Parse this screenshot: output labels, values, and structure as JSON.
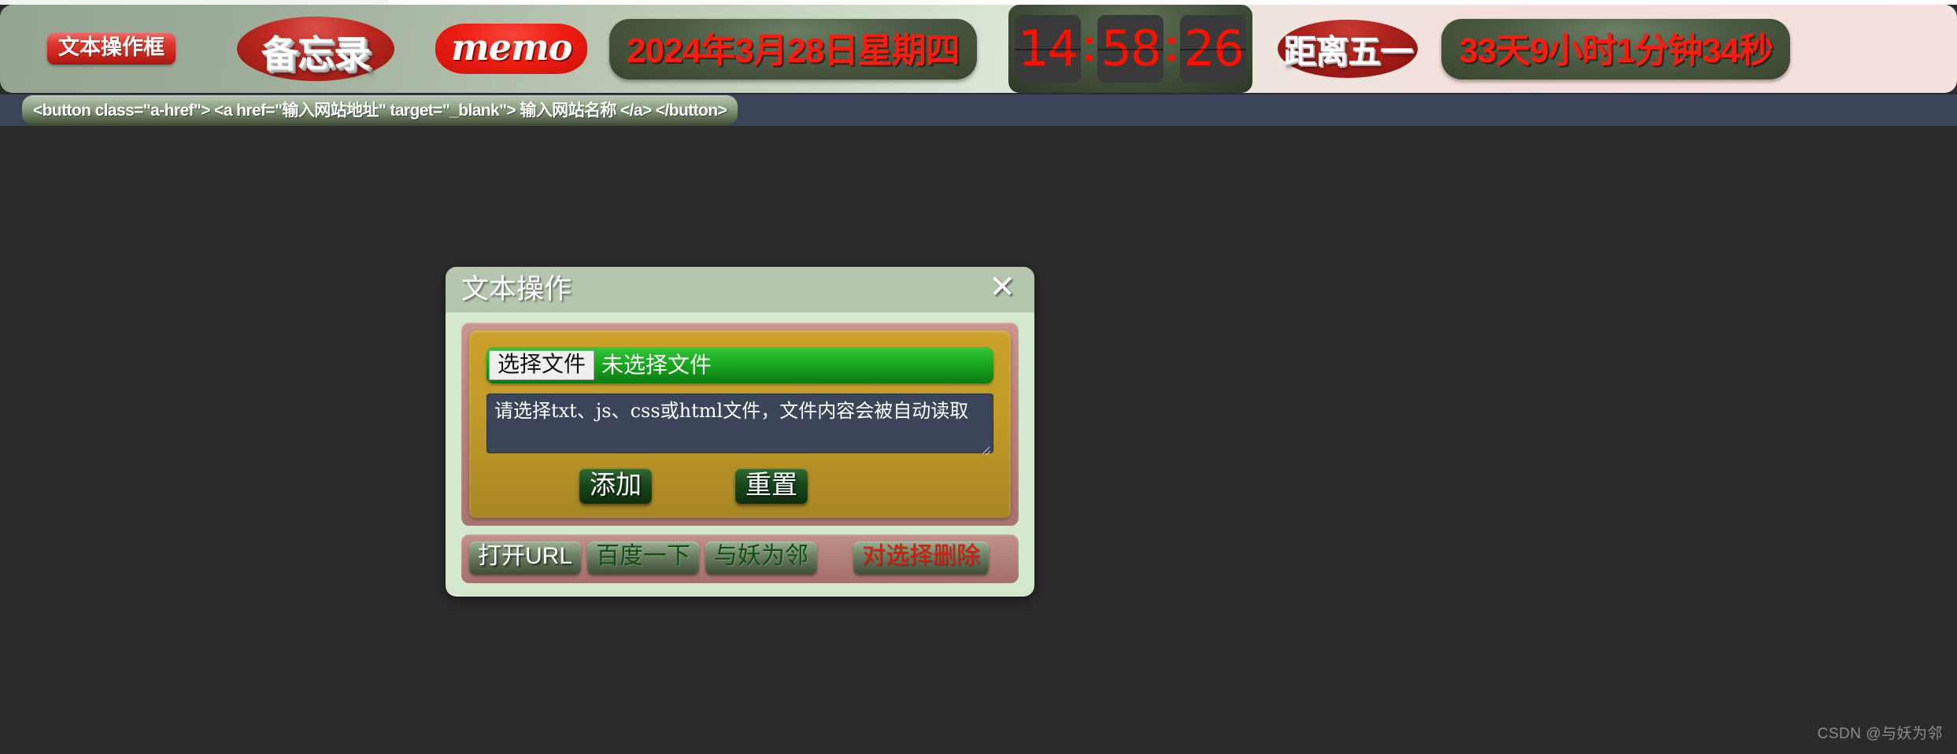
{
  "toolbar": {
    "text_box_button": "文本操作框",
    "memo_cn_button": "备忘录",
    "memo_en_button": "memo",
    "date_display": "2024年3月28日星期四",
    "clock": {
      "hours": "14",
      "minutes": "58",
      "seconds": "26",
      "separator": ":",
      "full": "14:58:26"
    },
    "countdown_label": "距离五一",
    "countdown_value": "33天9小时1分钟34秒"
  },
  "codebar": {
    "snippet": "<button class=\"a-href\"> <a href=\"输入网站地址\" target=\"_blank\"> 输入网站名称 </a> </button>"
  },
  "dialog": {
    "title": "文本操作",
    "close_label": "✕",
    "file_input": {
      "button_label": "选择文件",
      "status_text": "未选择文件"
    },
    "textarea": {
      "value": "请选择txt、js、css或html文件，文件内容会被自动读取",
      "placeholder": "请选择txt、js、css或html文件，文件内容会被自动读取"
    },
    "actions": {
      "add_label": "添加",
      "reset_label": "重置"
    },
    "footer_buttons": [
      {
        "label": "打开URL",
        "style": "white"
      },
      {
        "label": "百度一下",
        "style": "green"
      },
      {
        "label": "与妖为邻",
        "style": "green"
      },
      {
        "label": "对选择删除",
        "style": "red"
      }
    ]
  },
  "watermark": "CSDN @与妖为邻",
  "colors": {
    "page_background": "#2b2b2b",
    "codebar_background": "#3b4458",
    "dialog_background": "#d3e8cd",
    "dialog_titlebar": "#b4c6ae",
    "rose_panel": "#bb8680",
    "gold_panel": "#c19a28",
    "file_input_green": "#18aa1c",
    "clock_digit_red": "#ff0f00",
    "accent_red": "#e03c33"
  }
}
